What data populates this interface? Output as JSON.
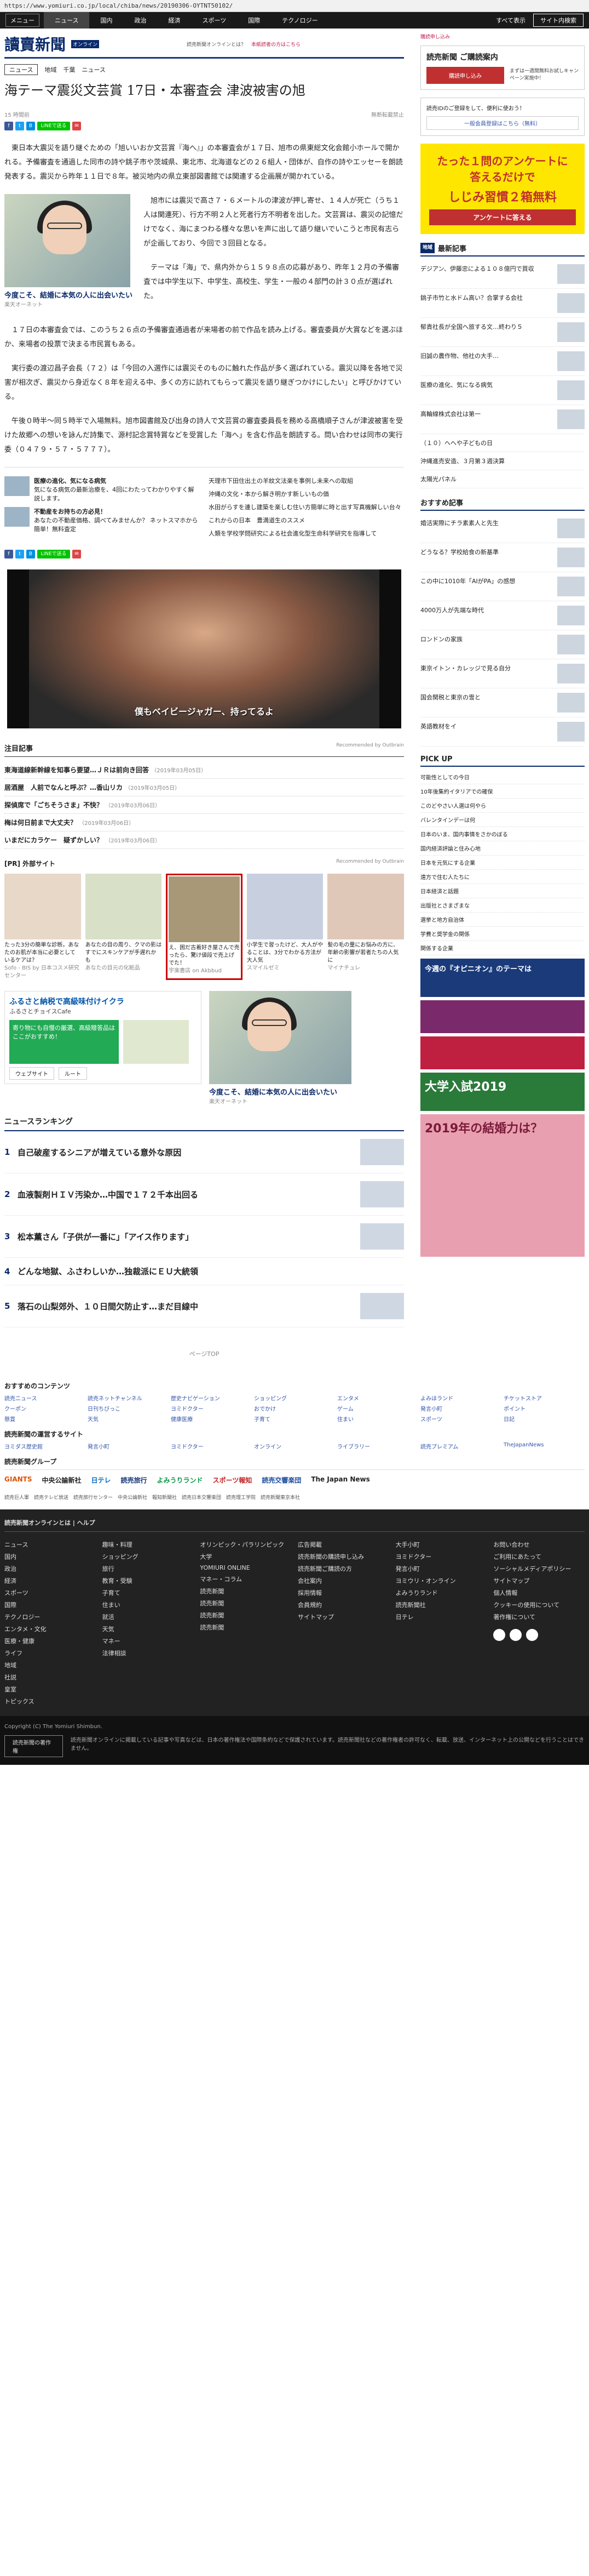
{
  "browser": {
    "url": "https://www.yomiuri.co.jp/local/chiba/news/20190306-OYTNT50102/"
  },
  "topnav": {
    "menu": "メニュー",
    "items": [
      "ニュース",
      "国内",
      "政治",
      "経済",
      "スポーツ",
      "国際",
      "テクノロジー"
    ],
    "all_news": "すべて表示",
    "login": "サイト内検索"
  },
  "header": {
    "logo": "讀賣新聞",
    "logo_sub": "オンライン",
    "link1": "読売新聞オンラインとは？",
    "link2": "本紙読者の方はこちら",
    "link3": "購読申し込み",
    "link4": "読売プレミアム"
  },
  "breadcrumb": {
    "tag": "ニュース",
    "items": [
      "地域",
      "千葉",
      "ニュース"
    ]
  },
  "article": {
    "title": "海テーマ震災文芸賞 17日・本審査会 津波被害の旭",
    "date": "15 時間前",
    "note": "無断転載禁止",
    "line_label": "LINEで送る",
    "p1": "東日本大震災を語り継ぐための「旭いいおか文芸賞『海へ』」の本審査会が１７日、旭市の県東総文化会館小ホールで開かれる。予備審査を通過した同市の詩や銚子市や茨城県、東北市、北海道などの２６組人・団体が、自作の詩やエッセーを朗読発表する。震災から昨年１１日で８年。被災地内の県立東部図書館では関連する企画展が開かれている。",
    "p2": "旭市には震災で高さ７・６メートルの津波が押し寄せ、１４人が死亡（うち１人は関連死）、行方不明２人と死者行方不明者を出した。文芸賞は、震災の記憶だけでなく、海にまつわる様々な思いを声に出して語り継いでいこうと市民有志らが企画しており、今回で３回目となる。",
    "p3": "テーマは「海」で、県内外から１５９８点の応募があり、昨年１２月の予備審査では中学生以下、中学生、高校生、学生・一般の４部門の計３０点が選ばれた。",
    "p4": "１７日の本審査会では、このうち２６点の予備審査通過者が来場者の前で作品を読み上げる。審査委員が大賞などを選ぶほか、来場者の投票で決まる市民賞もある。",
    "p5": "実行委の渡辺昌子会長（７２）は「今回の入選作には震災そのものに触れた作品が多く選ばれている。震災以降を各地で災害が相次ぎ、震災から身近なく８年を迎える中、多くの方に訪れてもらって震災を語り継ぎつかけにしたい」と呼びかけている。",
    "p6": "午後０時半〜同５時半で入場無料。旭市図書館及び出身の詩人で文芸賞の審査委員長を務める高橋順子さんが津波被害を受けた故郷への想いを詠んだ詩集で、源村記念賞特賞などを受賞した「海へ」を含む作品を朗読する。問い合わせは同市の実行委（０４７９・５７・５７７７）。"
  },
  "ad1": {
    "caption": "今度こそ、結婚に本気の人に出会いたい",
    "sponsor": "楽天オーネット"
  },
  "related": {
    "left": [
      {
        "title": "医療の進化、気になる病気",
        "desc": "気になる病気の最新治療を、4回にわたってわかりやすく解説します。"
      },
      {
        "title": "不動産をお持ちの方必見！",
        "desc": "あなたの不動産価格、調べてみませんか？ ネットスマホから簡単！無料査定"
      }
    ],
    "right": [
      "天理市下田住出土の羊紋文法楽を事例し未来への取組",
      "沖縄の文化・本から解き明かす新しいもの価",
      "水田がらすを連し建築を楽しむ住い方簡単に時と出す写真機解しい台々",
      "これからの日本　豊満道生のススメ",
      "人類を学校学問研究による社会進化型生命科学研究を指導して"
    ]
  },
  "video": {
    "caption": "僕もベイビージャガー、持ってるよ"
  },
  "recommend": {
    "title": "注目記事",
    "badge": "Recommended by Outbrain",
    "items": [
      {
        "text": "東海道線新幹線を知事ら要望…ＪＲは前向き回答",
        "date": "（2019年03月05日）"
      },
      {
        "text": "居酒屋　人前でなんと呼ぶ？…香山リカ",
        "date": "（2019年03月05日）"
      },
      {
        "text": "探偵席で「ごちそうさま」不快？",
        "date": "（2019年03月06日）"
      },
      {
        "text": "梅は何日前まで大丈夫？",
        "date": "（2019年03月06日）"
      },
      {
        "text": "いまだにカラケー　疑ずかしい？",
        "date": "（2019年03月06日）"
      }
    ]
  },
  "outside": {
    "title": "[PR] 外部サイト",
    "badge": "Recommended by Outbrain",
    "items": [
      {
        "text": "たった3分の簡単な診断。あなたのお肌が本当に必要としているケアは？",
        "src": "Sofo - BIS by 日本コスメ研究センター"
      },
      {
        "text": "あなたの目の周り、クマの影はすでにスキンケアが手遅れかも",
        "src": "あなたの目元の化粧品"
      },
      {
        "text": "え、困だ古着好き屋さんで売ったら、驚け値段で売上げでた！",
        "src": "宇楽書店 on Akbbud"
      },
      {
        "text": "小学生で習ったけど、大人がやることは、3分でわかる方法が大人気",
        "src": "スマイルゼミ"
      },
      {
        "text": "髪の毛の量にお悩みの方に、年齢の影響が若者たちの人気に",
        "src": "マイナチュレ"
      }
    ]
  },
  "promo": {
    "title": "ふるさと納税で高級味付けイクラ",
    "sub": "ふるさとチョイスCafe",
    "green": "寄り物にも自慢の厳選、高級贈答品はここがおすすめ！",
    "btn1": "ウェブサイト",
    "btn2": "ルート",
    "ad_caption": "今度こそ、結婚に本気の人に出会いたい",
    "ad_sponsor": "楽天オーネット"
  },
  "ranking": {
    "title": "ニュースランキング",
    "items": [
      {
        "num": "1",
        "text": "自己破産するシニアが増えている意外な原因"
      },
      {
        "num": "2",
        "text": "血液製剤ＨＩＶ汚染か…中国で１７２千本出回る"
      },
      {
        "num": "3",
        "text": "松本薫さん「子供が一番に」「アイス作ります」"
      },
      {
        "num": "4",
        "text": "どんな地獄、ふさわしいか…独裁派にＥＵ大統領"
      },
      {
        "num": "5",
        "text": "落石の山梨郊外、１０日間欠防止す…まだ目線中"
      }
    ]
  },
  "pagetop": "ページTOP",
  "side": {
    "sub_title": "読売新聞 ご購読案内",
    "sub_btn": "購読申し込み",
    "sub_note": "まずは一週間無料お試しキャンペーン実施中！",
    "notice": "読売IDのご登録をして、便利に使おう！",
    "notice_btn": "一般会員登録はこちら（無料）",
    "quiz_line1": "たった１問のアンケートに",
    "quiz_line2": "答えるだけで",
    "quiz_line3": "しじみ習慣２箱無料",
    "quiz_cta": "アンケートに答える",
    "latest_tag": "地域",
    "latest_title": "最新記事",
    "latest": [
      "デジアン、伊藤忠による１０８億円で買収",
      "銚子市竹と水ドム高い？合掌する会社",
      "郁貴社長が全国へ旅する文…終わり５",
      "旧誠の農作物、他社の大手…",
      "医療の進化、気になる病気",
      "高輪線株式会社は第一",
      "（１０）へへや子どもの日",
      "沖縄進売安造、３月第３週決算",
      "太陽光パネル"
    ],
    "must_title": "おすすめ記事",
    "must": [
      "婚活実際にチラ素素人と先生",
      "どうなる？学校給食の新基準",
      "この中に1010年「AIがPA」の感想",
      "4000万人が先端な時代",
      "ロンドンの家族",
      "東京イトン・カレッジで見る自分",
      "国会関税と東京の雪と",
      "英語教材をイ"
    ],
    "pickup_title": "PICK UP",
    "pickup": [
      "可能性としての今日",
      "10年後集約イタリアでの確保",
      "このどやさい人選は何やら",
      "バレンタインデーは何",
      "日本のいま、国内事情をさかのぼる",
      "国内経済評論と住み心地",
      "日本を元気にする企業",
      "遠方で住む人たちに",
      "日本経済と話題",
      "出版社とさまざまな",
      "選挙と地方自治体",
      "学費と奨学金の関係",
      "関係する企業"
    ],
    "banner1": "今週の『オピニオン』のテーマは",
    "banner2": "大学入試2019",
    "banner3": "2019年の結婚力は？"
  },
  "footer": {
    "contents_title": "おすすめのコンテンツ",
    "contents": [
      "読売ニュース",
      "読売ネットチャンネル",
      "歴史ナビゲーション",
      "ショッピング",
      "エンタメ",
      "よみほランド",
      "チケットストア",
      "クーポン",
      "日刊ちびっこ",
      "ヨミドクター",
      "おでかけ",
      "ゲーム",
      "発言小町",
      "ポイント",
      "懸賞",
      "天気",
      "健康医療",
      "子育て",
      "住まい",
      "スポーツ",
      "日記"
    ],
    "partners_title": "読売新聞の運営するサイト",
    "partners": [
      "ヨミダス歴史館",
      "発言小町",
      "ヨミドクター",
      "オンライン",
      "ライブラリー",
      "読売プレミアム",
      "TheJapanNews"
    ],
    "group_label": "読売新聞グループ",
    "group": [
      "GIANTS",
      "中央公論新社",
      "日テレ",
      "読売旅行",
      "よみうりランド",
      "スポーツ報知",
      "読売交響楽団",
      "The Japan News"
    ],
    "group_row": "読売巨人軍　読売テレビ放送　読売旅行センター　中央公論新社　報知新聞社　読売日本交響楽団　読売理工学院　読売新聞東京本社",
    "dark_top": "読売新聞オンラインとは | ヘルプ",
    "dark_cols": [
      [
        "ニュース",
        "国内",
        "政治",
        "経済",
        "スポーツ",
        "国際",
        "テクノロジー",
        "エンタメ・文化",
        "医療・健康",
        "ライフ",
        "地域",
        "社説",
        "皇室",
        "トピックス"
      ],
      [
        "趣味・料理",
        "ショッピング",
        "旅行",
        "教育・受験",
        "子育て",
        "住まい",
        "就活",
        "天気",
        "マネー",
        "法律相談"
      ],
      [
        "オリンピック・パラリンピック",
        "大学",
        "YOMIURI ONLINE",
        "マネー・コラム",
        "読売新聞",
        "読売新聞",
        "読売新聞",
        "読売新聞"
      ],
      [
        "広告掲載",
        "読売新聞の購読申し込み",
        "読売新聞ご購読の方",
        "会社案内",
        "採用情報",
        "会員規約",
        "サイトマップ"
      ],
      [
        "大手小町",
        "ヨミドクター",
        "発言小町",
        "ヨミウリ・オンライン",
        "よみうりランド",
        "読売新聞社",
        "日テレ"
      ],
      [
        "お問い合わせ",
        "ご利用にあたって",
        "ソーシャルメディアポリシー",
        "サイトマップ",
        "個人情報",
        "クッキーの使用について",
        "著作権について"
      ]
    ],
    "copyright": "Copyright (C) The Yomiuri Shimbun.",
    "bottom_btn": "読売新聞の著作権",
    "bottom_text": "読売新聞オンラインに掲載している記事や写真などは、日本の著作権法や国際条約などで保護されています。読売新聞社などの著作権者の許可なく、転載、放送、インターネット上の公開などを行うことはできません。"
  }
}
